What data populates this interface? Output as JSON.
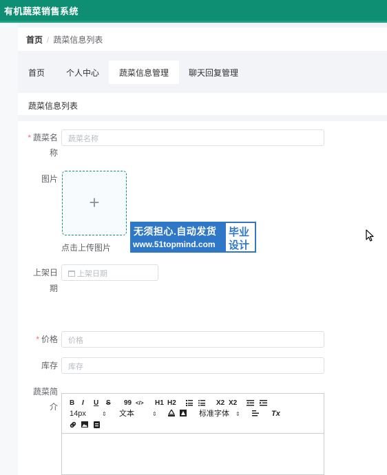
{
  "app": {
    "title": "有机蔬菜销售系统"
  },
  "breadcrumb": {
    "home": "首页",
    "separator": "/",
    "current": "蔬菜信息列表"
  },
  "tabs": [
    {
      "label": "首页"
    },
    {
      "label": "个人中心"
    },
    {
      "label": "蔬菜信息管理",
      "active": true
    },
    {
      "label": "聊天回复管理"
    }
  ],
  "subtitle": "蔬菜信息列表",
  "form": {
    "name": {
      "required_mark": "*",
      "label_line1": "蔬菜名",
      "label_line2": "称",
      "placeholder": "蔬菜名称"
    },
    "image": {
      "label": "图片",
      "upload_plus": "+",
      "upload_tip": "点击上传图片"
    },
    "date": {
      "label_line1": "上架日",
      "label_line2": "期",
      "placeholder": "上架日期"
    },
    "price": {
      "required_mark": "*",
      "label": "价格",
      "placeholder": "价格"
    },
    "stock": {
      "label": "库存",
      "placeholder": "库存"
    },
    "intro": {
      "label_line1": "蔬菜简",
      "label_line2": "介"
    }
  },
  "editor_toolbar": {
    "bold": "B",
    "italic": "I",
    "underline": "U",
    "strike": "S",
    "quote": "99",
    "code": "</>",
    "h1": "H1",
    "h2": "H2",
    "subscript": "X2",
    "superscript": "X2",
    "font_size": "14px",
    "text_style": "文本",
    "font_family": "标准字体",
    "clear_format": "Tx",
    "icons": [
      "ordered-list-icon",
      "bullet-list-icon",
      "outdent-icon",
      "indent-icon",
      "font-color-icon",
      "background-color-icon",
      "align-icon",
      "link-icon",
      "image-icon",
      "video-icon"
    ]
  },
  "watermark": {
    "line1": "无须担心.自动发货",
    "line2": "www.51topmind.com",
    "badge1": "毕业",
    "badge2": "设计"
  },
  "colors": {
    "header": "#0e8f73",
    "required": "#f56c6c",
    "upload_border": "#0e8f73",
    "watermark": "#2e78c7"
  }
}
